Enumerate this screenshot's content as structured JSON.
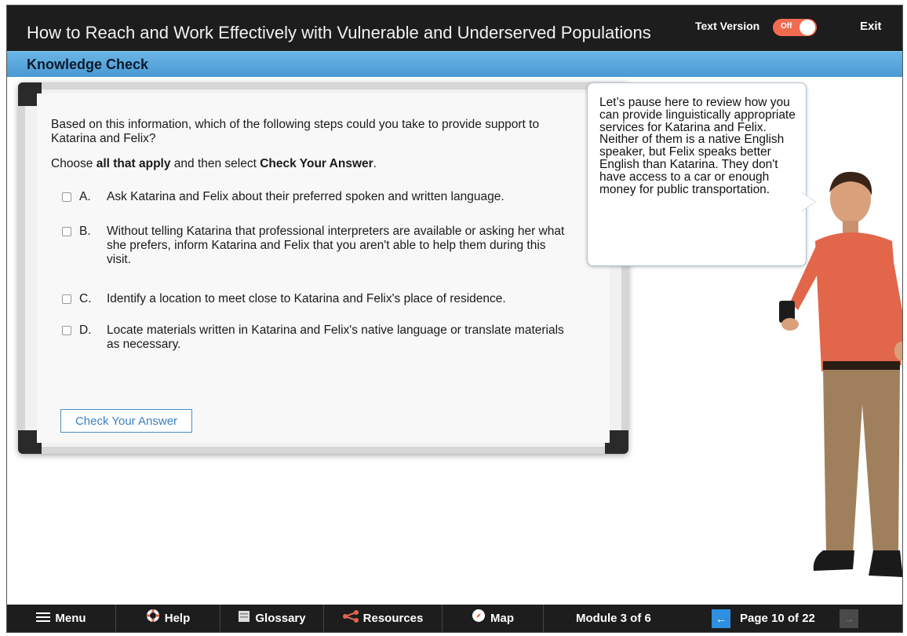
{
  "header": {
    "title": "How to Reach and Work Effectively with Vulnerable and Underserved Populations",
    "text_version_label": "Text Version",
    "toggle_state": "Off",
    "exit_label": "Exit"
  },
  "section": {
    "title": "Knowledge Check"
  },
  "question": {
    "prompt": "Based on this information, which of the following steps could you take to provide support to Katarina and Felix?",
    "instruction_pre": "Choose ",
    "instruction_bold1": "all that apply",
    "instruction_mid": " and then select ",
    "instruction_bold2": "Check Your Answer",
    "instruction_post": ".",
    "options": [
      {
        "letter": "A.",
        "text": "Ask Katarina and Felix about their preferred spoken and written language.",
        "checked": false
      },
      {
        "letter": "B.",
        "text": "Without telling Katarina that professional interpreters are available or asking her what she prefers, inform Katarina and Felix that you aren't able to help them during this visit.",
        "checked": false
      },
      {
        "letter": "C.",
        "text": "Identify a location to meet close to Katarina and Felix's place of residence.",
        "checked": false
      },
      {
        "letter": "D.",
        "text": "Locate materials written in Katarina and Felix's native language or translate materials as necessary.",
        "checked": false
      }
    ],
    "check_button": "Check Your Answer"
  },
  "bubble": {
    "text": "Let’s pause here to review how you can provide linguistically appropriate services for Katarina and Felix. Neither of them is a native English speaker, but Felix speaks better English than Katarina. They don't have access to a car or enough money for public transportation."
  },
  "footer": {
    "menu": "Menu",
    "help": "Help",
    "glossary": "Glossary",
    "resources": "Resources",
    "map": "Map",
    "module": "Module 3 of 6",
    "page": "Page 10 of 22"
  },
  "colors": {
    "accent_blue": "#4a99d2",
    "toggle_orange": "#f26a4f",
    "bar_dark": "#1d1d1d"
  }
}
